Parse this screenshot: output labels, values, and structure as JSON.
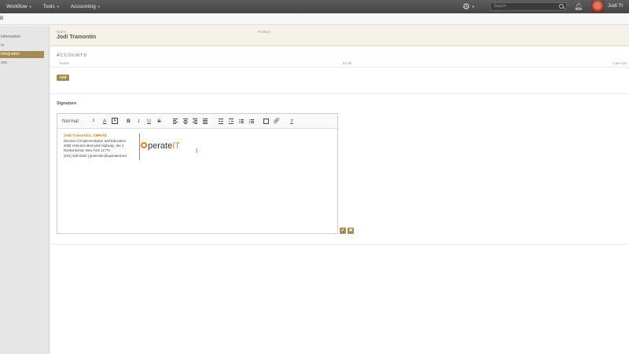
{
  "nav": {
    "menus": [
      {
        "label": "Workflow"
      },
      {
        "label": "Tools"
      },
      {
        "label": "Accounting"
      }
    ],
    "search_placeholder": "Search",
    "user_name": "Jodi Tr"
  },
  "breadcrumb": {
    "text": "B"
  },
  "sidebar": {
    "items": [
      {
        "label": "Information",
        "active": false
      },
      {
        "label": "rs",
        "active": false
      },
      {
        "label": "Integration",
        "active": true
      },
      {
        "label": "ces",
        "active": false
      }
    ]
  },
  "profile": {
    "name_label": "Name",
    "name_value": "Jodi Tramontin",
    "position_label": "Position"
  },
  "accounts": {
    "title": "ACCOUNTS",
    "columns": [
      "Name",
      "Email",
      "Last Syn"
    ],
    "add_label": "Add"
  },
  "signature": {
    "title": "Signature",
    "toolbar": {
      "format_select": "Normal"
    },
    "content": {
      "name": "Jodi Tramontin, CMRAD",
      "lines": [
        "Director of Implementation and Education",
        "2605 Veterans Memorial Highway, Ste 2",
        "Ronkonkoma, New York  11779",
        "(631) 629-2283  |  jtramontin@operateit.net"
      ],
      "logo_main": "perate",
      "logo_accent": "IT"
    }
  },
  "colors": {
    "accent": "#a68a55",
    "orange": "#e67e22",
    "topbar": "#4f4f4f"
  }
}
